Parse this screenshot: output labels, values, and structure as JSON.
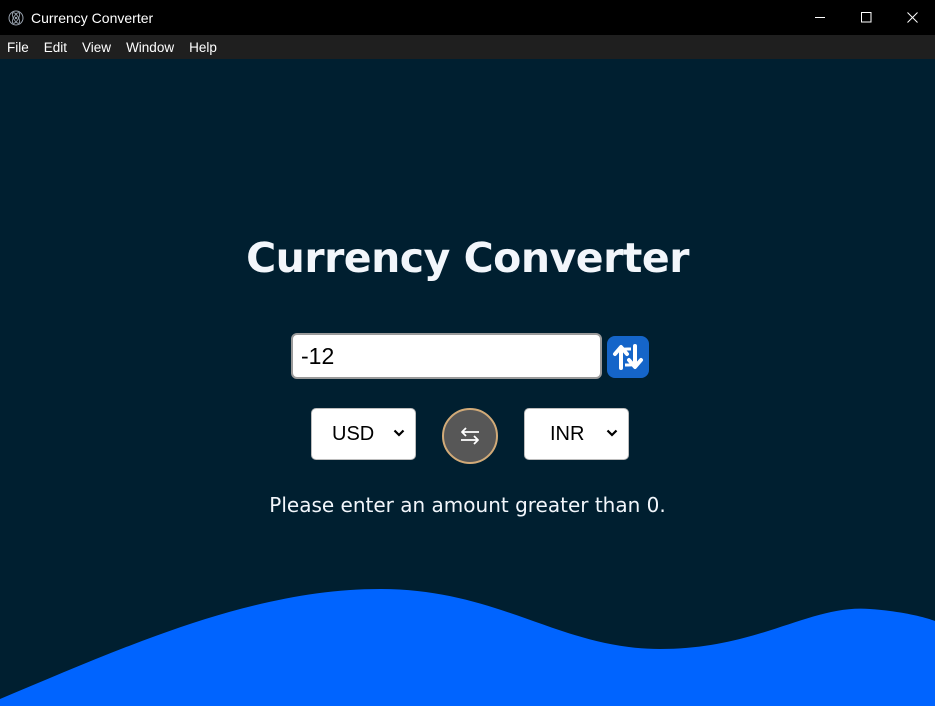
{
  "window": {
    "title": "Currency Converter",
    "controls": [
      "minimize-icon",
      "maximize-icon",
      "close-icon"
    ]
  },
  "menu": {
    "items": [
      "File",
      "Edit",
      "View",
      "Window",
      "Help"
    ]
  },
  "app": {
    "heading": "Currency Converter",
    "amount_value": "-12",
    "convert_icon": "exchange-arrows-icon",
    "from_currency": "USD",
    "to_currency": "INR",
    "swap_icon": "swap-arrows-icon",
    "message": "Please enter an amount greater than 0."
  },
  "colors": {
    "background": "#001f30",
    "wave": "#0064ff",
    "convert_button": "#1565c9",
    "swap_button": "#575757",
    "swap_border": "#d1aa78"
  }
}
